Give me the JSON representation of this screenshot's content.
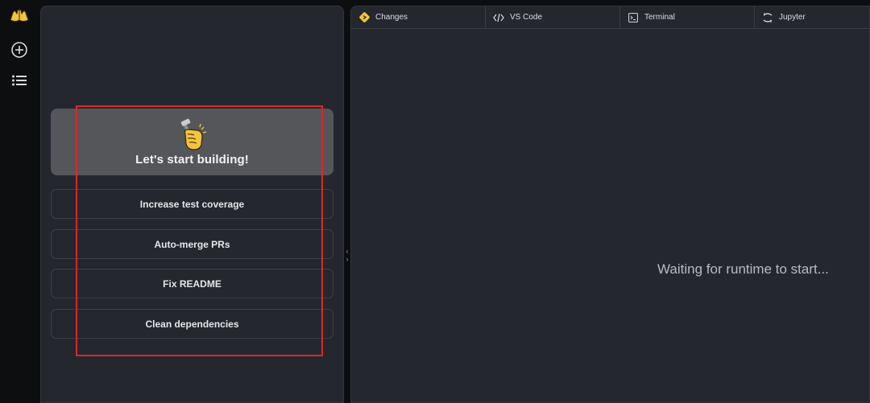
{
  "rail": {
    "icons": [
      "praying-hands-logo-icon",
      "plus-circle-icon",
      "list-icon"
    ]
  },
  "chat": {
    "hero": {
      "icon": "raised-fist-hammer-icon",
      "title": "Let's start building!"
    },
    "suggestions": [
      {
        "label": "Increase test coverage"
      },
      {
        "label": "Auto-merge PRs"
      },
      {
        "label": "Fix README"
      },
      {
        "label": "Clean dependencies"
      }
    ]
  },
  "workspace": {
    "tabs": [
      {
        "label": "Changes",
        "icon": "git-diff-icon"
      },
      {
        "label": "VS Code",
        "icon": "code-icon"
      },
      {
        "label": "Terminal",
        "icon": "terminal-icon"
      },
      {
        "label": "Jupyter",
        "icon": "jupyter-icon"
      }
    ],
    "status": "Waiting for runtime to start..."
  },
  "colors": {
    "accent_yellow": "#f3c53c",
    "highlight_red": "#e0262b",
    "panel_bg": "#24272e",
    "rail_bg": "#0d0e10"
  }
}
